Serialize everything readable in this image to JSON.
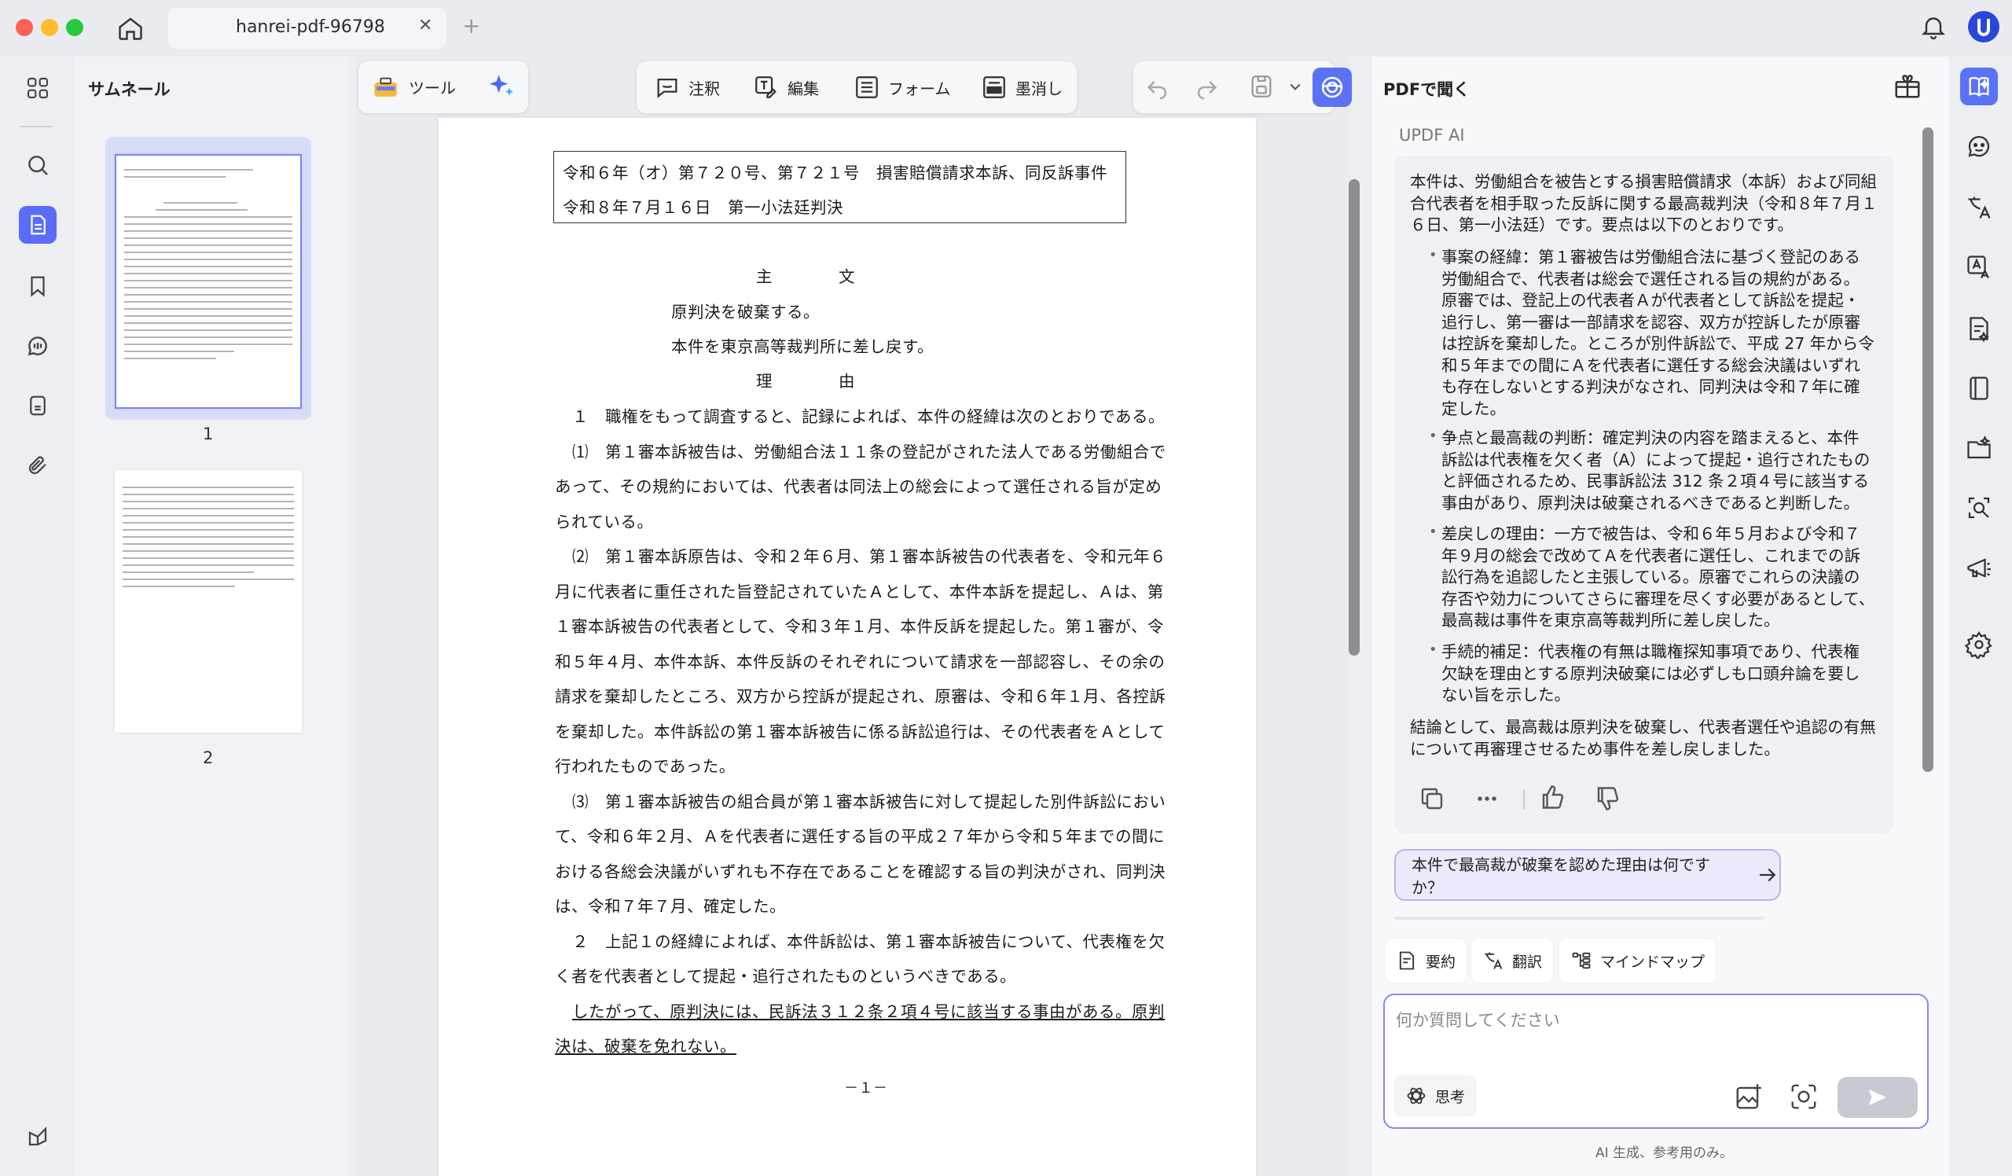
{
  "window": {
    "tab_title": "hanrei-pdf-96798",
    "new_tab_symbol": "+",
    "close_symbol": "✕"
  },
  "thumbnails": {
    "title": "サムネール",
    "pages": [
      "1",
      "2"
    ]
  },
  "toolbar": {
    "tools_label": "ツール",
    "annotate_label": "注釈",
    "edit_label": "編集",
    "form_label": "フォーム",
    "redact_label": "墨消し"
  },
  "document": {
    "case_line1": "令和６年（オ）第７２０号、第７２１号　損害賠償請求本訴、同反訴事件",
    "case_line2": "令和８年７月１６日　第一小法廷判決",
    "heading_main": "主　　　　文",
    "main_line1": "原判決を破棄する。",
    "main_line2": "本件を東京高等裁判所に差し戻す。",
    "heading_reason": "理　　　　由",
    "lines": [
      "１　職権をもって調査すると、記録によれば、本件の経緯は次のとおりである。",
      "⑴　第１審本訴被告は、労働組合法１１条の登記がされた法人である労働組合で",
      "あって、その規約においては、代表者は同法上の総会によって選任される旨が定め",
      "られている。",
      "⑵　第１審本訴原告は、令和２年６月、第１審本訴被告の代表者を、令和元年６",
      "月に代表者に重任された旨登記されていたＡとして、本件本訴を提起し、Ａは、第",
      "１審本訴被告の代表者として、令和３年１月、本件反訴を提起した。第１審が、令",
      "和５年４月、本件本訴、本件反訴のそれぞれについて請求を一部認容し、その余の",
      "請求を棄却したところ、双方から控訴が提起され、原審は、令和６年１月、各控訴",
      "を棄却した。本件訴訟の第１審本訴被告に係る訴訟追行は、その代表者をＡとして",
      "行われたものであった。",
      "⑶　第１審本訴被告の組合員が第１審本訴被告に対して提起した別件訴訟におい",
      "て、令和６年２月、Ａを代表者に選任する旨の平成２７年から令和５年までの間に",
      "おける各総会決議がいずれも不存在であることを確認する旨の判決がされ、同判決",
      "は、令和７年７月、確定した。",
      "２　上記１の経緯によれば、本件訴訟は、第１審本訴被告について、代表権を欠",
      "く者を代表者として提起・追行されたものというべきである。",
      "したがって、原判決には、民訴法３１２条２項４号に該当する事由がある。原判",
      "決は、破棄を免れない。"
    ],
    "page_number": "－１－"
  },
  "ai": {
    "header": "PDFで聞く",
    "subtitle": "UPDF AI",
    "intro": "本件は、労働組合を被告とする損害賠償請求（本訴）および同組合代表者を相手取った反訴に関する最高裁判決（令和８年７月１６日、第一小法廷）です。要点は以下のとおりです。",
    "bullets": [
      "事案の経緯：第１審被告は労働組合法に基づく登記のある労働組合で、代表者は総会で選任される旨の規約がある。原審では、登記上の代表者Ａが代表者として訴訟を提起・追行し、第一審は一部請求を認容、双方が控訴したが原審は控訴を棄却した。ところが別件訴訟で、平成 27 年から令和５年までの間にＡを代表者に選任する総会決議はいずれも存在しないとする判決がなされ、同判決は令和７年に確定した。",
      "争点と最高裁の判断：確定判決の内容を踏まえると、本件訴訟は代表権を欠く者（A）によって提起・追行されたものと評価されるため、民事訴訟法 312 条２項４号に該当する事由があり、原判決は破棄されるべきであると判断した。",
      "差戻しの理由：一方で被告は、令和６年５月および令和７年９月の総会で改めてＡを代表者に選任し、これまでの訴訟行為を追認したと主張している。原審でこれらの決議の存否や効力についてさらに審理を尽くす必要があるとして、最高裁は事件を東京高等裁判所に差し戻した。",
      "手続的補足：代表権の有無は職権探知事項であり、代表権欠缺を理由とする原判決破棄には必ずしも口頭弁論を要しない旨を示した。"
    ],
    "conclusion": "結論として、最高裁は原判決を破棄し、代表者選任や追認の有無について再審理させるため事件を差し戻しました。",
    "suggestion": "本件で最高裁が破棄を認めた理由は何ですか？",
    "chips": [
      "要約",
      "翻訳",
      "マインドマップ"
    ],
    "input_placeholder": "何か質問してください",
    "think_label": "思考",
    "footnote": "AI 生成、参考用のみ。"
  }
}
